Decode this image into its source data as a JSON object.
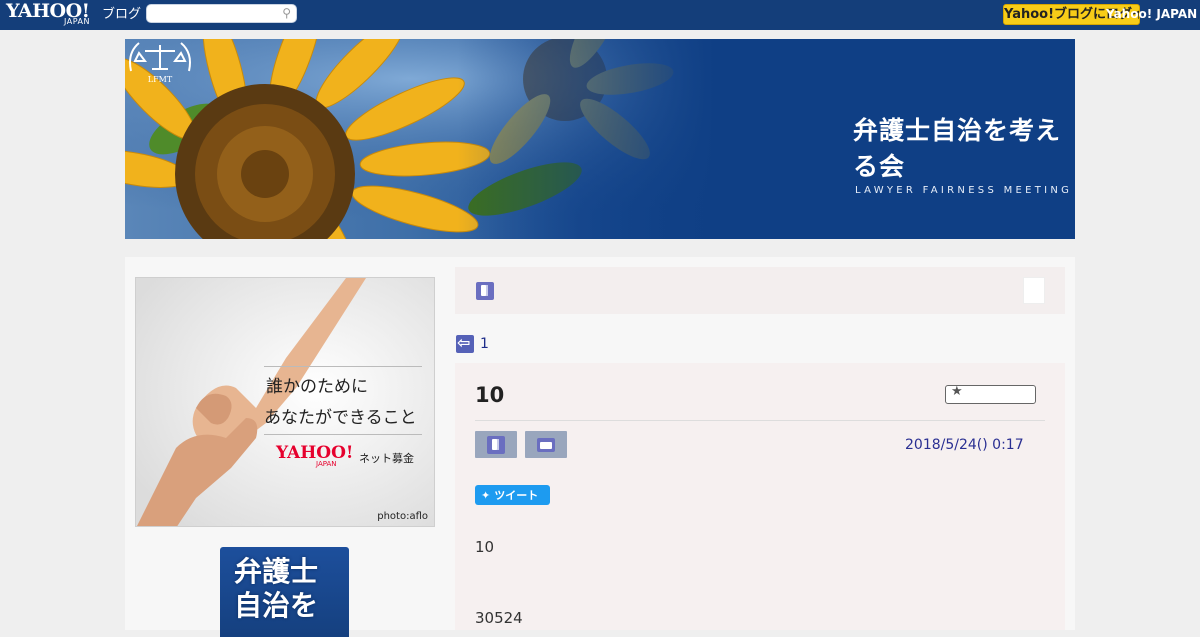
{
  "header": {
    "logo_text": "YAHOO!",
    "logo_sub": "JAPAN",
    "service_name": "ブログ",
    "search_placeholder": "",
    "yellow_button_label": "Yahoo!ブログにログイン",
    "top_link_label": "Yahoo! JAPAN"
  },
  "banner": {
    "title": "弁護士自治を考える会",
    "subtitle": "LAWYER FAIRNESS MEETING THINKS",
    "emblem_text": "LFMT"
  },
  "sidebar": {
    "ad": {
      "line1": "誰かのために",
      "line2": "あなたができること",
      "logo_text": "YAHOO!",
      "logo_sub": "JAPAN",
      "service_text": "ネット募金",
      "credit": "photo:aflo"
    },
    "book_title": "弁護士自治を"
  },
  "category_bar": {
    "icon": "book-icon"
  },
  "nav": {
    "prev_label": "1"
  },
  "article": {
    "title": "10",
    "date": "2018/5/24()  0:17",
    "tweet_label": "ツイート",
    "body_line1": "10",
    "body_line2": "30524"
  },
  "colors": {
    "topbar": "#143e7a",
    "yellow_button": "#f7cc18",
    "link": "#2a2f92",
    "tweet": "#1d9bf0"
  }
}
